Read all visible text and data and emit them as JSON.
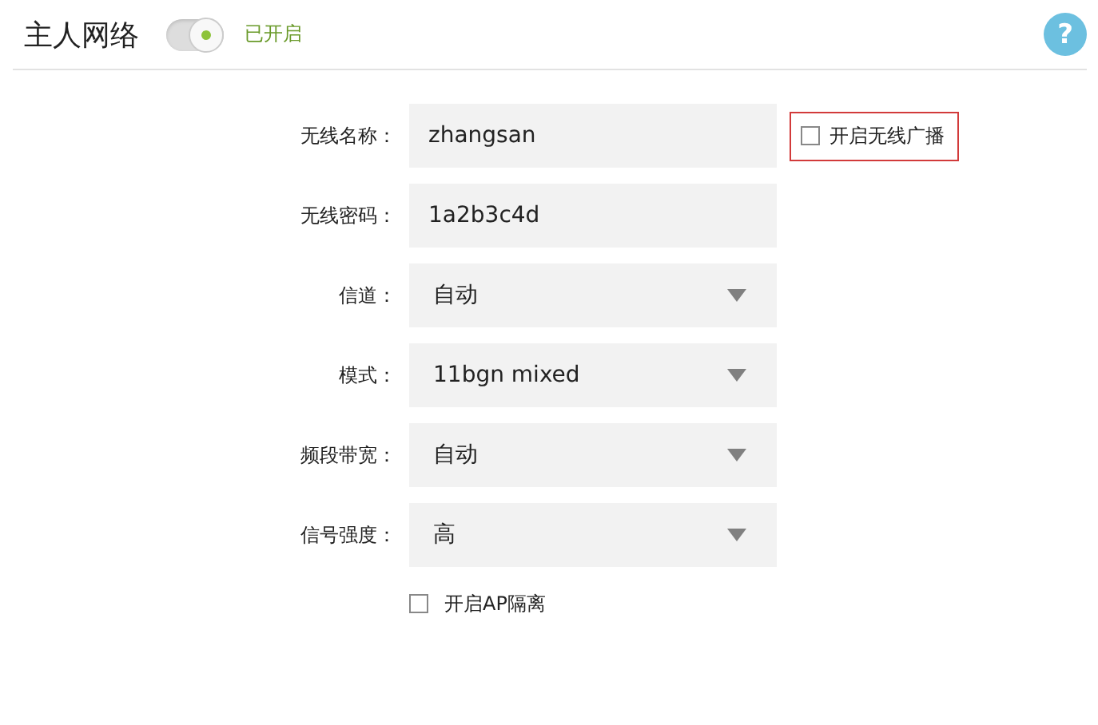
{
  "header": {
    "title": "主人网络",
    "toggle": {
      "on": true
    },
    "status": "已开启",
    "help": "?"
  },
  "fields": [
    {
      "label": "无线名称：",
      "kind": "text",
      "value": "zhangsan",
      "extra": {
        "label": "开启无线广播",
        "checked": false
      }
    },
    {
      "label": "无线密码：",
      "kind": "text",
      "value": "1a2b3c4d"
    },
    {
      "label": "信道：",
      "kind": "select",
      "value": "自动"
    },
    {
      "label": "模式：",
      "kind": "select",
      "value": "11bgn mixed"
    },
    {
      "label": "频段带宽：",
      "kind": "select",
      "value": "自动"
    },
    {
      "label": "信号强度：",
      "kind": "select",
      "value": "高"
    }
  ],
  "ap_isolation": {
    "label": "开启AP隔离",
    "checked": false
  }
}
